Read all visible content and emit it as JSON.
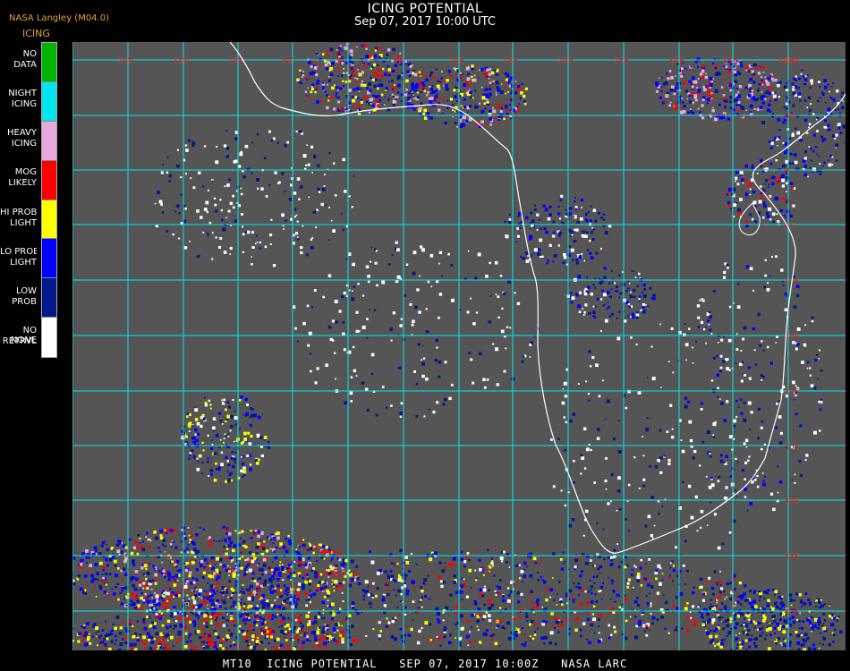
{
  "header": {
    "title": "ICING POTENTIAL",
    "datetime": "Sep 07, 2017 10:00 UTC",
    "source": "NASA Langley (M04.0)",
    "product": "ICING"
  },
  "legend": [
    {
      "label": "NO DATA",
      "color": "#00b400"
    },
    {
      "label": "NIGHT ICING",
      "color": "#00e6ee"
    },
    {
      "label": "HEAVY ICING",
      "color": "#e8aadc"
    },
    {
      "label": "MOG LIKELY",
      "color": "#ff0000"
    },
    {
      "label": "HI PROB LIGHT",
      "color": "#ffff00"
    },
    {
      "label": "LO PROB LIGHT",
      "color": "#0000ff"
    },
    {
      "label": "LOW PROB",
      "color": "#001a8c"
    },
    {
      "label": "NO RETRVL",
      "color": "#ffffff"
    },
    {
      "label": "NONE",
      "color": "#555555"
    }
  ],
  "map": {
    "background_color": "#555555",
    "grid_color": "#00e6ee",
    "coast_color": "#ffffff",
    "lon_labels": [
      "20W",
      "15W",
      "10W",
      "5W",
      "0",
      "5E",
      "10E",
      "15E",
      "20E",
      "25E",
      "30E",
      "35E",
      "40E"
    ],
    "lat_labels": [
      "10N",
      "5N",
      "0",
      "5S",
      "10S",
      "15S",
      "20S",
      "25S",
      "30S",
      "35S",
      "40S"
    ]
  },
  "footer": "MT10  ICING POTENTIAL   SEP 07, 2017 10:00Z   NASA LARC"
}
